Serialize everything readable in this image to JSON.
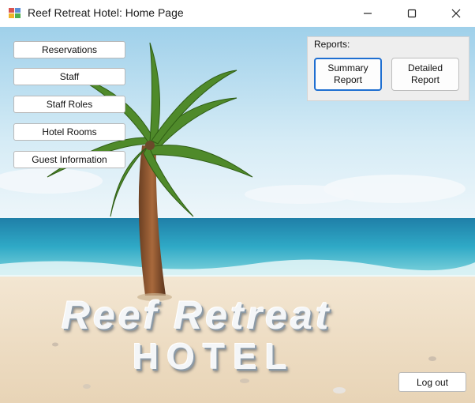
{
  "window": {
    "title": "Reef Retreat Hotel: Home Page"
  },
  "nav": {
    "reservations": "Reservations",
    "staff": "Staff",
    "staff_roles": "Staff Roles",
    "hotel_rooms": "Hotel Rooms",
    "guest_information": "Guest Information"
  },
  "reports": {
    "label": "Reports:",
    "summary": "Summary\nReport",
    "detailed": "Detailed\nReport"
  },
  "logout": "Log out",
  "background": {
    "line1": "Reef  Retreat",
    "line2": "HOTEL",
    "colors": {
      "sky": "#bfe3f3",
      "sea": "#2fa6c4",
      "sand": "#efe0c8",
      "palm_leaf": "#4f8a2a"
    }
  }
}
